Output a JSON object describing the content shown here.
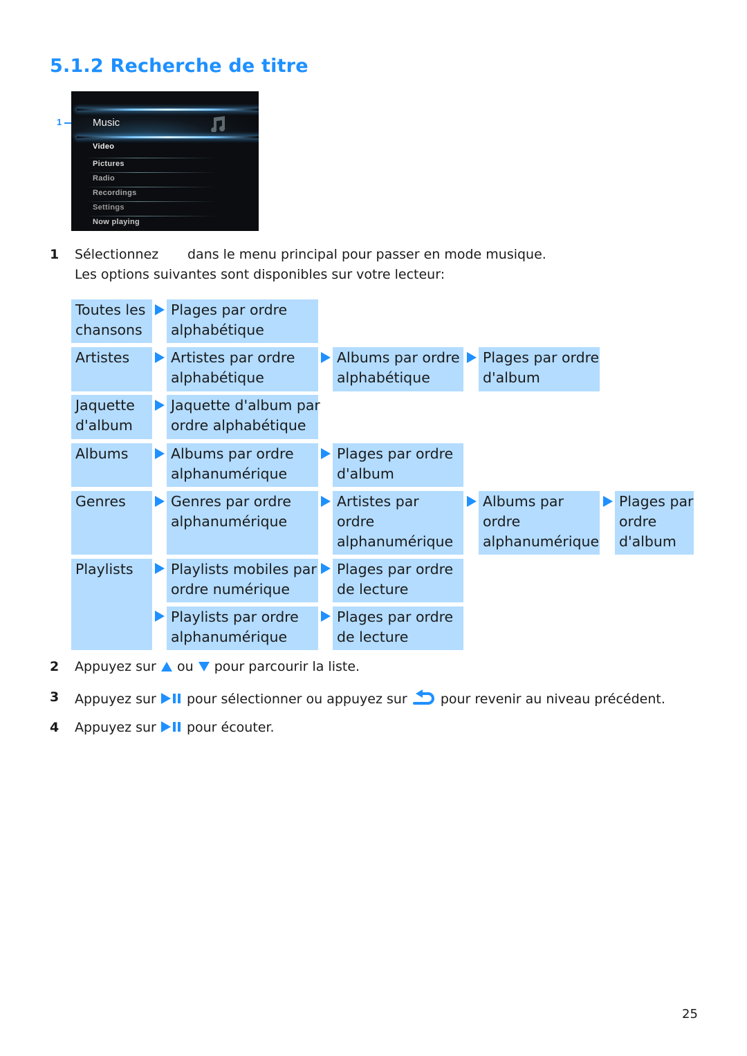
{
  "heading": "5.1.2 Recherche de titre",
  "device_screen": {
    "callout_number": "1",
    "selected_item": "Music",
    "selected_icon": "music-note-icon",
    "menu_items": [
      "Video",
      "Pictures",
      "Radio",
      "Recordings",
      "Settings",
      "Now playing"
    ]
  },
  "steps": [
    {
      "num": "1",
      "line1_a": "Sélectionnez",
      "line1_b": "dans le menu principal pour passer en mode musique.",
      "line2": "Les options suivantes sont disponibles sur votre lecteur:"
    },
    {
      "num": "2",
      "a": "Appuyez sur",
      "b": "ou",
      "c": "pour parcourir la liste."
    },
    {
      "num": "3",
      "a": "Appuyez sur",
      "b": "pour sélectionner ou appuyez sur",
      "c": "pour revenir au niveau précédent."
    },
    {
      "num": "4",
      "a": "Appuyez sur",
      "b": "pour écouter."
    }
  ],
  "navigation_table": {
    "rows": [
      {
        "category": "Toutes les chansons",
        "levels": [
          [
            "Plages par ordre alphabétique"
          ]
        ]
      },
      {
        "category": "Artistes",
        "levels": [
          [
            "Artistes par ordre alphabétique",
            "Albums par ordre alphabétique",
            "Plages par ordre d'album"
          ]
        ]
      },
      {
        "category": "Jaquette d'album",
        "levels": [
          [
            "Jaquette d'album par ordre alphabétique"
          ]
        ]
      },
      {
        "category": "Albums",
        "levels": [
          [
            "Albums par ordre alphanumérique",
            "Plages par ordre d'album"
          ]
        ]
      },
      {
        "category": "Genres",
        "levels": [
          [
            "Genres par ordre alphanumérique",
            "Artistes par ordre alphanumérique",
            "Albums par ordre alphanumérique",
            "Plages par ordre d'album"
          ]
        ]
      },
      {
        "category": "Playlists",
        "levels": [
          [
            "Playlists mobiles par ordre numérique",
            "Plages par ordre de lecture"
          ],
          [
            "Playlists par ordre alphanumérique",
            "Plages par ordre de lecture"
          ]
        ]
      }
    ],
    "cells": {
      "c_toutes": "Toutes les\nchansons",
      "c_toutes_1": "Plages par ordre\nalphabétique",
      "c_artistes": "Artistes",
      "c_artistes_1": "Artistes par ordre\nalphabétique",
      "c_artistes_2": "Albums par ordre\nalphabétique",
      "c_artistes_3": "Plages par ordre\nd'album",
      "c_jaquette": "Jaquette\nd'album",
      "c_jaquette_1": "Jaquette d'album par\nordre alphabétique",
      "c_albums": "Albums",
      "c_albums_1": "Albums par ordre\nalphanumérique",
      "c_albums_2": "Plages par ordre\nd'album",
      "c_genres": "Genres",
      "c_genres_1": "Genres par ordre\nalphanumérique",
      "c_genres_2": "Artistes par\nordre\nalphanumérique",
      "c_genres_3": "Albums par\nordre\nalphanumérique",
      "c_genres_4": "Plages par\nordre\nd'album",
      "c_playlists": "Playlists",
      "c_playlists_1": "Playlists mobiles par\nordre numérique",
      "c_playlists_2": "Plages par ordre\nde lecture",
      "c_playlists_3": "Playlists par ordre\nalphanumérique",
      "c_playlists_4": "Plages par ordre\nde lecture"
    }
  },
  "icons": {
    "up": "up-arrow-icon",
    "down": "down-arrow-icon",
    "play_pause": "play-pause-icon",
    "back": "back-icon"
  },
  "colors": {
    "accent": "#1e90ff",
    "cell_bg": "#b3dcff"
  },
  "page_number": "25"
}
